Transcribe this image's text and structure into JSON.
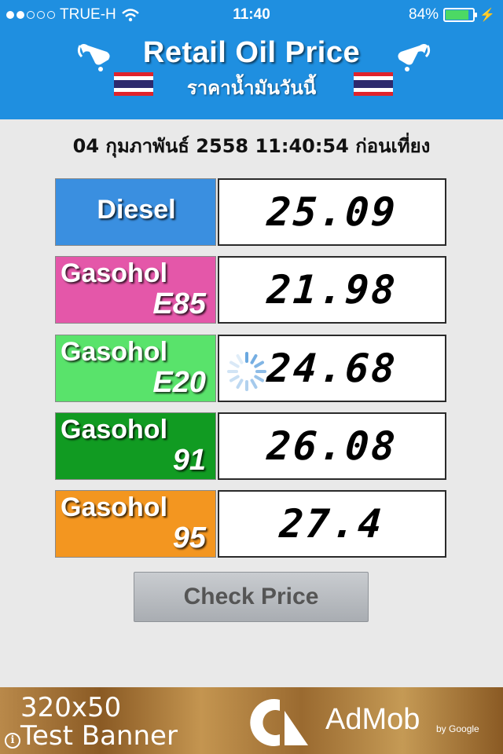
{
  "status_bar": {
    "carrier": "TRUE-H",
    "time": "11:40",
    "battery": "84%",
    "battery_level": 0.84
  },
  "header": {
    "title": "Retail Oil Price",
    "subtitle": "ราคาน้ำมันวันนี้",
    "color": "#1f8fe0"
  },
  "datetime": "04 กุมภาพันธ์ 2558 11:40:54 ก่อนเที่ยง",
  "fuels": [
    {
      "top": "Diesel",
      "bottom": "",
      "price": "25.09",
      "color": "#3a8fe0"
    },
    {
      "top": "Gasohol",
      "bottom": "E85",
      "price": "21.98",
      "color": "#e457a9"
    },
    {
      "top": "Gasohol",
      "bottom": "E20",
      "price": "24.68",
      "color": "#59e36b"
    },
    {
      "top": "Gasohol",
      "bottom": "91",
      "price": "26.08",
      "color": "#119b22"
    },
    {
      "top": "Gasohol",
      "bottom": "95",
      "price": "27.4",
      "color": "#f39620"
    }
  ],
  "check_button": "Check Price",
  "ad_banner": {
    "line1": "320x50",
    "line2": "Test Banner",
    "brand": "AdMob",
    "by": "by Google"
  }
}
